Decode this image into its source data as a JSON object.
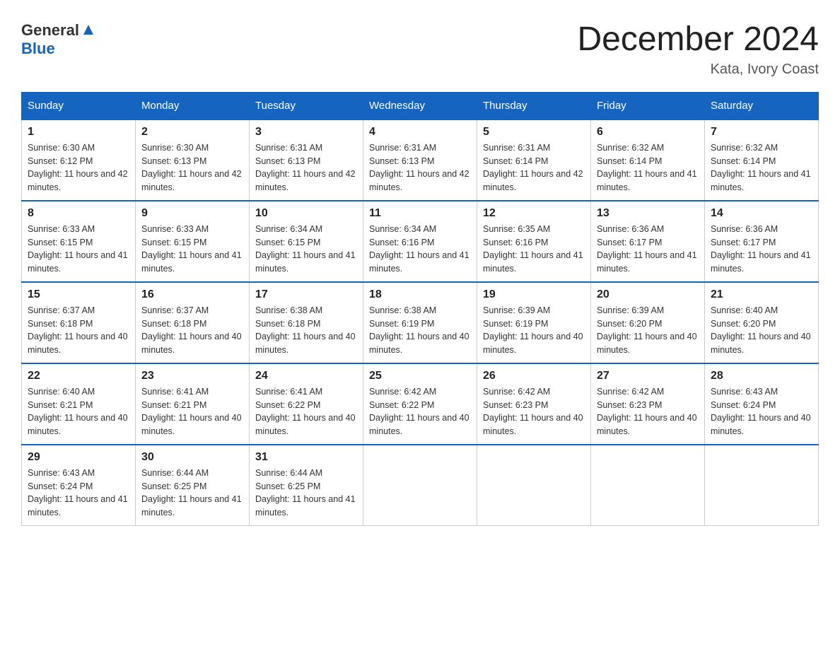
{
  "header": {
    "logo_general": "General",
    "logo_blue": "Blue",
    "month_title": "December 2024",
    "location": "Kata, Ivory Coast"
  },
  "days_of_week": [
    "Sunday",
    "Monday",
    "Tuesday",
    "Wednesday",
    "Thursday",
    "Friday",
    "Saturday"
  ],
  "weeks": [
    [
      {
        "day": "1",
        "sunrise": "6:30 AM",
        "sunset": "6:12 PM",
        "daylight": "11 hours and 42 minutes."
      },
      {
        "day": "2",
        "sunrise": "6:30 AM",
        "sunset": "6:13 PM",
        "daylight": "11 hours and 42 minutes."
      },
      {
        "day": "3",
        "sunrise": "6:31 AM",
        "sunset": "6:13 PM",
        "daylight": "11 hours and 42 minutes."
      },
      {
        "day": "4",
        "sunrise": "6:31 AM",
        "sunset": "6:13 PM",
        "daylight": "11 hours and 42 minutes."
      },
      {
        "day": "5",
        "sunrise": "6:31 AM",
        "sunset": "6:14 PM",
        "daylight": "11 hours and 42 minutes."
      },
      {
        "day": "6",
        "sunrise": "6:32 AM",
        "sunset": "6:14 PM",
        "daylight": "11 hours and 41 minutes."
      },
      {
        "day": "7",
        "sunrise": "6:32 AM",
        "sunset": "6:14 PM",
        "daylight": "11 hours and 41 minutes."
      }
    ],
    [
      {
        "day": "8",
        "sunrise": "6:33 AM",
        "sunset": "6:15 PM",
        "daylight": "11 hours and 41 minutes."
      },
      {
        "day": "9",
        "sunrise": "6:33 AM",
        "sunset": "6:15 PM",
        "daylight": "11 hours and 41 minutes."
      },
      {
        "day": "10",
        "sunrise": "6:34 AM",
        "sunset": "6:15 PM",
        "daylight": "11 hours and 41 minutes."
      },
      {
        "day": "11",
        "sunrise": "6:34 AM",
        "sunset": "6:16 PM",
        "daylight": "11 hours and 41 minutes."
      },
      {
        "day": "12",
        "sunrise": "6:35 AM",
        "sunset": "6:16 PM",
        "daylight": "11 hours and 41 minutes."
      },
      {
        "day": "13",
        "sunrise": "6:36 AM",
        "sunset": "6:17 PM",
        "daylight": "11 hours and 41 minutes."
      },
      {
        "day": "14",
        "sunrise": "6:36 AM",
        "sunset": "6:17 PM",
        "daylight": "11 hours and 41 minutes."
      }
    ],
    [
      {
        "day": "15",
        "sunrise": "6:37 AM",
        "sunset": "6:18 PM",
        "daylight": "11 hours and 40 minutes."
      },
      {
        "day": "16",
        "sunrise": "6:37 AM",
        "sunset": "6:18 PM",
        "daylight": "11 hours and 40 minutes."
      },
      {
        "day": "17",
        "sunrise": "6:38 AM",
        "sunset": "6:18 PM",
        "daylight": "11 hours and 40 minutes."
      },
      {
        "day": "18",
        "sunrise": "6:38 AM",
        "sunset": "6:19 PM",
        "daylight": "11 hours and 40 minutes."
      },
      {
        "day": "19",
        "sunrise": "6:39 AM",
        "sunset": "6:19 PM",
        "daylight": "11 hours and 40 minutes."
      },
      {
        "day": "20",
        "sunrise": "6:39 AM",
        "sunset": "6:20 PM",
        "daylight": "11 hours and 40 minutes."
      },
      {
        "day": "21",
        "sunrise": "6:40 AM",
        "sunset": "6:20 PM",
        "daylight": "11 hours and 40 minutes."
      }
    ],
    [
      {
        "day": "22",
        "sunrise": "6:40 AM",
        "sunset": "6:21 PM",
        "daylight": "11 hours and 40 minutes."
      },
      {
        "day": "23",
        "sunrise": "6:41 AM",
        "sunset": "6:21 PM",
        "daylight": "11 hours and 40 minutes."
      },
      {
        "day": "24",
        "sunrise": "6:41 AM",
        "sunset": "6:22 PM",
        "daylight": "11 hours and 40 minutes."
      },
      {
        "day": "25",
        "sunrise": "6:42 AM",
        "sunset": "6:22 PM",
        "daylight": "11 hours and 40 minutes."
      },
      {
        "day": "26",
        "sunrise": "6:42 AM",
        "sunset": "6:23 PM",
        "daylight": "11 hours and 40 minutes."
      },
      {
        "day": "27",
        "sunrise": "6:42 AM",
        "sunset": "6:23 PM",
        "daylight": "11 hours and 40 minutes."
      },
      {
        "day": "28",
        "sunrise": "6:43 AM",
        "sunset": "6:24 PM",
        "daylight": "11 hours and 40 minutes."
      }
    ],
    [
      {
        "day": "29",
        "sunrise": "6:43 AM",
        "sunset": "6:24 PM",
        "daylight": "11 hours and 41 minutes."
      },
      {
        "day": "30",
        "sunrise": "6:44 AM",
        "sunset": "6:25 PM",
        "daylight": "11 hours and 41 minutes."
      },
      {
        "day": "31",
        "sunrise": "6:44 AM",
        "sunset": "6:25 PM",
        "daylight": "11 hours and 41 minutes."
      },
      null,
      null,
      null,
      null
    ]
  ]
}
